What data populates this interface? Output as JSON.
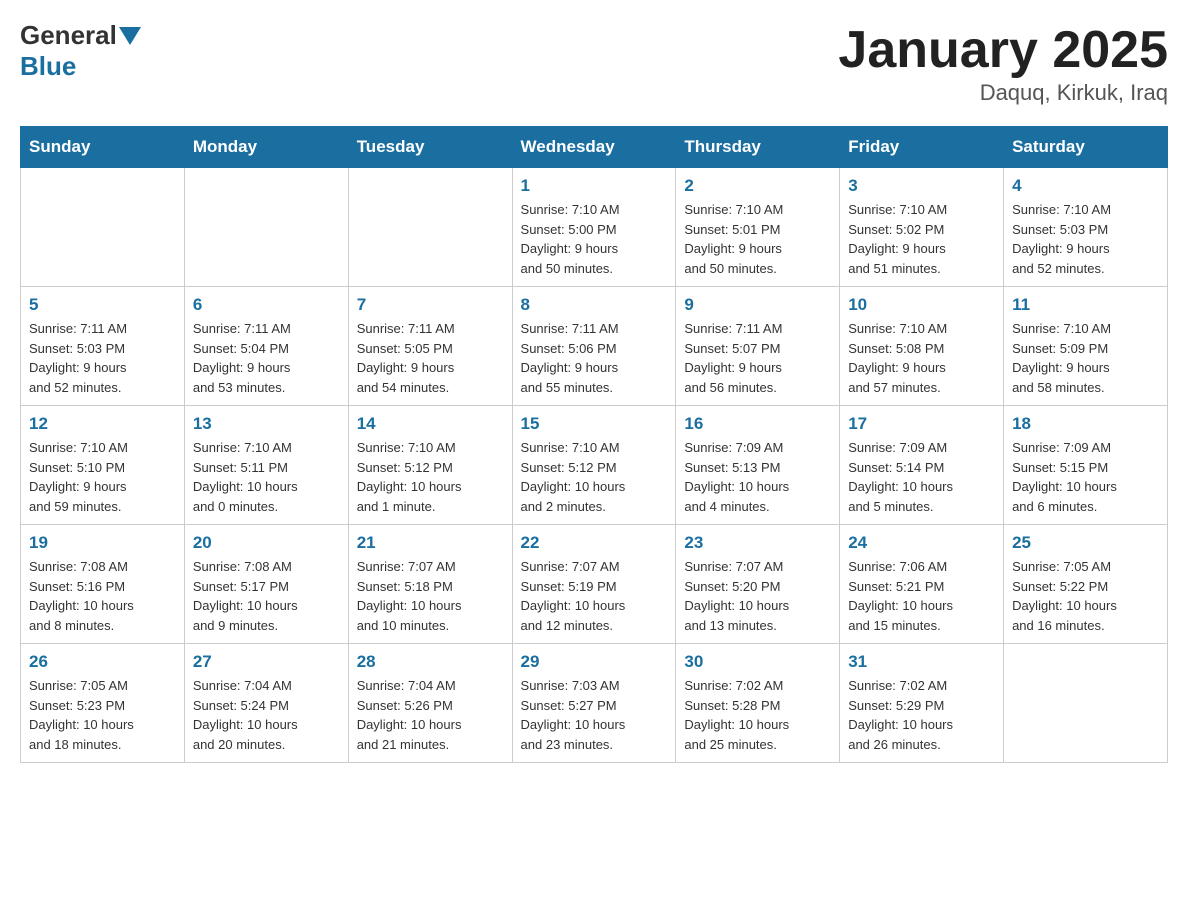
{
  "header": {
    "logo_general": "General",
    "logo_blue": "Blue",
    "title": "January 2025",
    "subtitle": "Daquq, Kirkuk, Iraq"
  },
  "days_of_week": [
    "Sunday",
    "Monday",
    "Tuesday",
    "Wednesday",
    "Thursday",
    "Friday",
    "Saturday"
  ],
  "weeks": [
    [
      {
        "day": "",
        "info": ""
      },
      {
        "day": "",
        "info": ""
      },
      {
        "day": "",
        "info": ""
      },
      {
        "day": "1",
        "info": "Sunrise: 7:10 AM\nSunset: 5:00 PM\nDaylight: 9 hours\nand 50 minutes."
      },
      {
        "day": "2",
        "info": "Sunrise: 7:10 AM\nSunset: 5:01 PM\nDaylight: 9 hours\nand 50 minutes."
      },
      {
        "day": "3",
        "info": "Sunrise: 7:10 AM\nSunset: 5:02 PM\nDaylight: 9 hours\nand 51 minutes."
      },
      {
        "day": "4",
        "info": "Sunrise: 7:10 AM\nSunset: 5:03 PM\nDaylight: 9 hours\nand 52 minutes."
      }
    ],
    [
      {
        "day": "5",
        "info": "Sunrise: 7:11 AM\nSunset: 5:03 PM\nDaylight: 9 hours\nand 52 minutes."
      },
      {
        "day": "6",
        "info": "Sunrise: 7:11 AM\nSunset: 5:04 PM\nDaylight: 9 hours\nand 53 minutes."
      },
      {
        "day": "7",
        "info": "Sunrise: 7:11 AM\nSunset: 5:05 PM\nDaylight: 9 hours\nand 54 minutes."
      },
      {
        "day": "8",
        "info": "Sunrise: 7:11 AM\nSunset: 5:06 PM\nDaylight: 9 hours\nand 55 minutes."
      },
      {
        "day": "9",
        "info": "Sunrise: 7:11 AM\nSunset: 5:07 PM\nDaylight: 9 hours\nand 56 minutes."
      },
      {
        "day": "10",
        "info": "Sunrise: 7:10 AM\nSunset: 5:08 PM\nDaylight: 9 hours\nand 57 minutes."
      },
      {
        "day": "11",
        "info": "Sunrise: 7:10 AM\nSunset: 5:09 PM\nDaylight: 9 hours\nand 58 minutes."
      }
    ],
    [
      {
        "day": "12",
        "info": "Sunrise: 7:10 AM\nSunset: 5:10 PM\nDaylight: 9 hours\nand 59 minutes."
      },
      {
        "day": "13",
        "info": "Sunrise: 7:10 AM\nSunset: 5:11 PM\nDaylight: 10 hours\nand 0 minutes."
      },
      {
        "day": "14",
        "info": "Sunrise: 7:10 AM\nSunset: 5:12 PM\nDaylight: 10 hours\nand 1 minute."
      },
      {
        "day": "15",
        "info": "Sunrise: 7:10 AM\nSunset: 5:12 PM\nDaylight: 10 hours\nand 2 minutes."
      },
      {
        "day": "16",
        "info": "Sunrise: 7:09 AM\nSunset: 5:13 PM\nDaylight: 10 hours\nand 4 minutes."
      },
      {
        "day": "17",
        "info": "Sunrise: 7:09 AM\nSunset: 5:14 PM\nDaylight: 10 hours\nand 5 minutes."
      },
      {
        "day": "18",
        "info": "Sunrise: 7:09 AM\nSunset: 5:15 PM\nDaylight: 10 hours\nand 6 minutes."
      }
    ],
    [
      {
        "day": "19",
        "info": "Sunrise: 7:08 AM\nSunset: 5:16 PM\nDaylight: 10 hours\nand 8 minutes."
      },
      {
        "day": "20",
        "info": "Sunrise: 7:08 AM\nSunset: 5:17 PM\nDaylight: 10 hours\nand 9 minutes."
      },
      {
        "day": "21",
        "info": "Sunrise: 7:07 AM\nSunset: 5:18 PM\nDaylight: 10 hours\nand 10 minutes."
      },
      {
        "day": "22",
        "info": "Sunrise: 7:07 AM\nSunset: 5:19 PM\nDaylight: 10 hours\nand 12 minutes."
      },
      {
        "day": "23",
        "info": "Sunrise: 7:07 AM\nSunset: 5:20 PM\nDaylight: 10 hours\nand 13 minutes."
      },
      {
        "day": "24",
        "info": "Sunrise: 7:06 AM\nSunset: 5:21 PM\nDaylight: 10 hours\nand 15 minutes."
      },
      {
        "day": "25",
        "info": "Sunrise: 7:05 AM\nSunset: 5:22 PM\nDaylight: 10 hours\nand 16 minutes."
      }
    ],
    [
      {
        "day": "26",
        "info": "Sunrise: 7:05 AM\nSunset: 5:23 PM\nDaylight: 10 hours\nand 18 minutes."
      },
      {
        "day": "27",
        "info": "Sunrise: 7:04 AM\nSunset: 5:24 PM\nDaylight: 10 hours\nand 20 minutes."
      },
      {
        "day": "28",
        "info": "Sunrise: 7:04 AM\nSunset: 5:26 PM\nDaylight: 10 hours\nand 21 minutes."
      },
      {
        "day": "29",
        "info": "Sunrise: 7:03 AM\nSunset: 5:27 PM\nDaylight: 10 hours\nand 23 minutes."
      },
      {
        "day": "30",
        "info": "Sunrise: 7:02 AM\nSunset: 5:28 PM\nDaylight: 10 hours\nand 25 minutes."
      },
      {
        "day": "31",
        "info": "Sunrise: 7:02 AM\nSunset: 5:29 PM\nDaylight: 10 hours\nand 26 minutes."
      },
      {
        "day": "",
        "info": ""
      }
    ]
  ]
}
